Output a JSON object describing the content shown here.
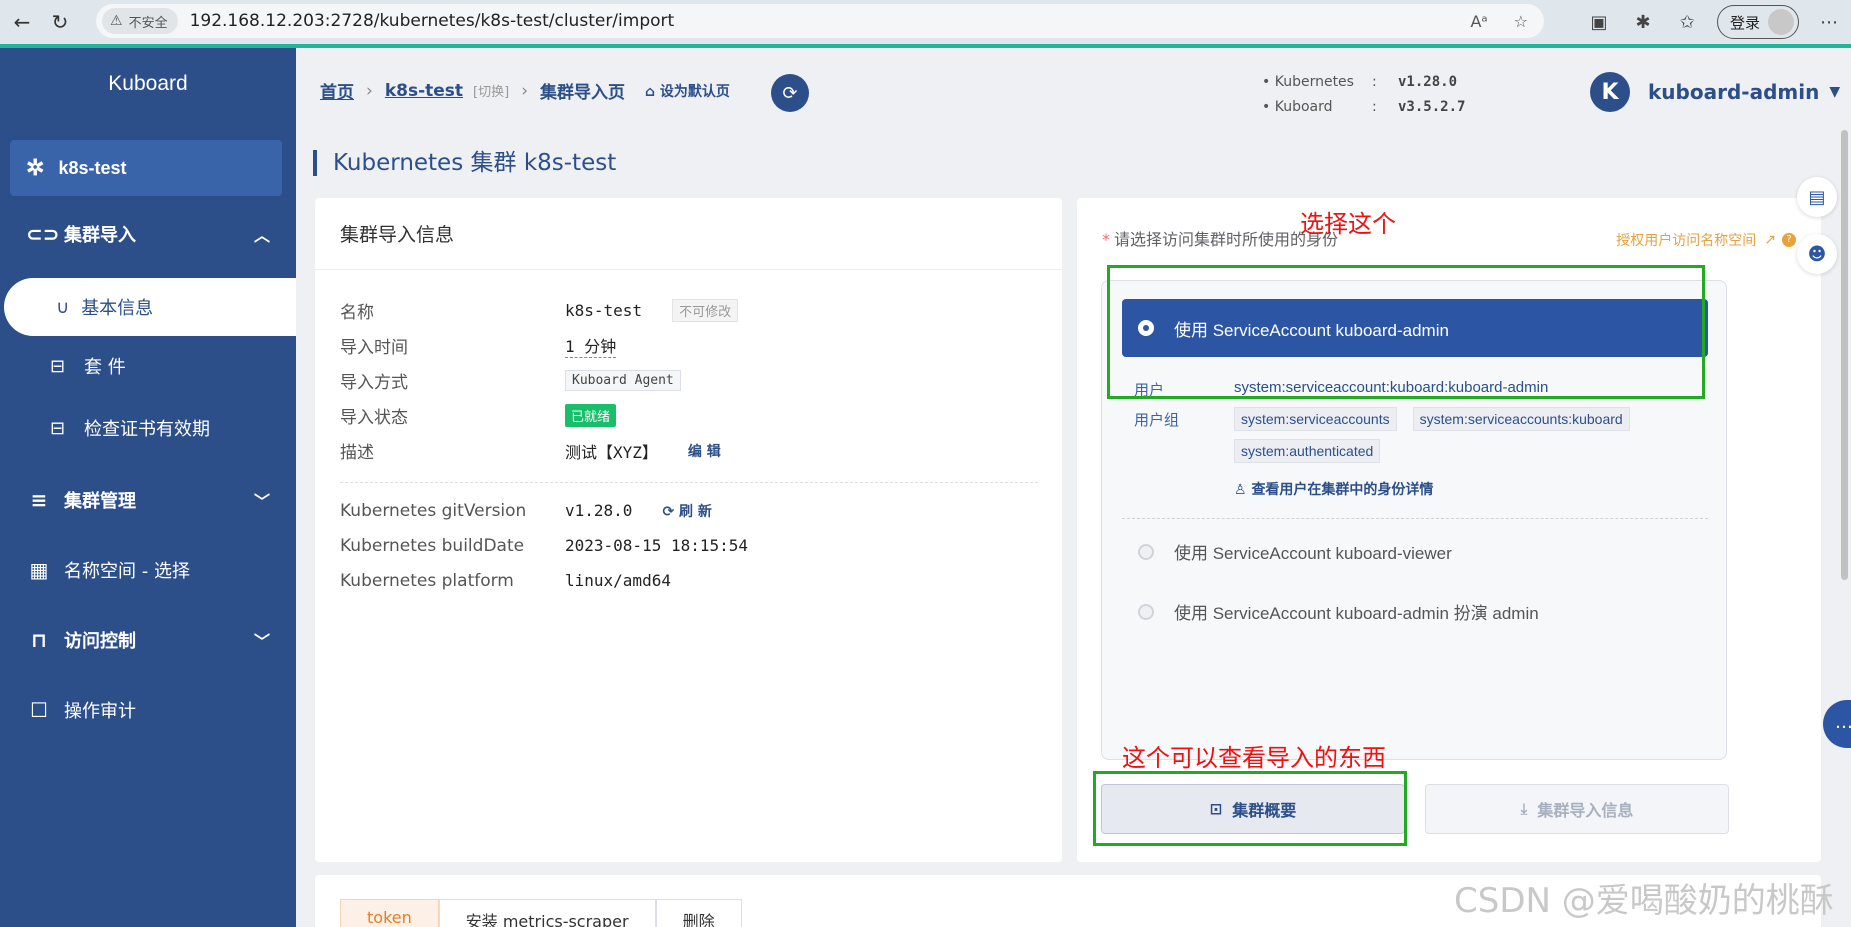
{
  "browser": {
    "insecure_label": "不安全",
    "url": "192.168.12.203:2728/kubernetes/k8s-test/cluster/import",
    "login_label": "登录"
  },
  "sidebar": {
    "brand": "Kuboard",
    "cluster": "k8s-test",
    "menu": {
      "import": "集群导入",
      "basic_info": "基本信息",
      "suite": "套 件",
      "cert_check": "检查证书有效期",
      "manage": "集群管理",
      "namespace": "名称空间 - 选择",
      "access": "访问控制",
      "audit": "操作审计"
    }
  },
  "header": {
    "home": "首页",
    "cluster": "k8s-test",
    "switch": "[切换]",
    "current": "集群导入页",
    "set_default": "设为默认页",
    "versions": [
      {
        "name": "Kubernetes",
        "value": "v1.28.0"
      },
      {
        "name": "Kuboard",
        "value": "v3.5.2.7"
      }
    ],
    "user_initial": "K",
    "user": "kuboard-admin"
  },
  "page_title": "Kubernetes 集群 k8s-test",
  "import_info": {
    "title": "集群导入信息",
    "rows": {
      "name_label": "名称",
      "name_value": "k8s-test",
      "name_tag": "不可修改",
      "time_label": "导入时间",
      "time_value": "1 分钟",
      "method_label": "导入方式",
      "method_value": "Kuboard Agent",
      "status_label": "导入状态",
      "status_value": "已就绪",
      "desc_label": "描述",
      "desc_value": "测试【XYZ】",
      "edit": "编 辑",
      "git_label": "Kubernetes gitVersion",
      "git_value": "v1.28.0",
      "refresh": "刷 新",
      "build_label": "Kubernetes buildDate",
      "build_value": "2023-08-15 18:15:54",
      "platform_label": "Kubernetes platform",
      "platform_value": "linux/amd64"
    }
  },
  "identity": {
    "label": "请选择访问集群时所使用的身份",
    "auth_link": "授权用户访问名称空间",
    "selected": "使用 ServiceAccount kuboard-admin",
    "user_label": "用户",
    "user_value": "system:serviceaccount:kuboard:kuboard-admin",
    "group_label": "用户组",
    "groups": [
      "system:serviceaccounts",
      "system:serviceaccounts:kuboard",
      "system:authenticated"
    ],
    "view_detail": "查看用户在集群中的身份详情",
    "option2": "使用 ServiceAccount kuboard-viewer",
    "option3": "使用 ServiceAccount kuboard-admin 扮演 admin"
  },
  "buttons": {
    "overview": "集群概要",
    "import_info": "集群导入信息"
  },
  "annotations": {
    "select_this": "选择这个",
    "view_import": "这个可以查看导入的东西"
  },
  "tabs": [
    "token",
    "安装 metrics-scraper",
    "删除"
  ],
  "watermark": "CSDN @爱喝酸奶的桃酥"
}
